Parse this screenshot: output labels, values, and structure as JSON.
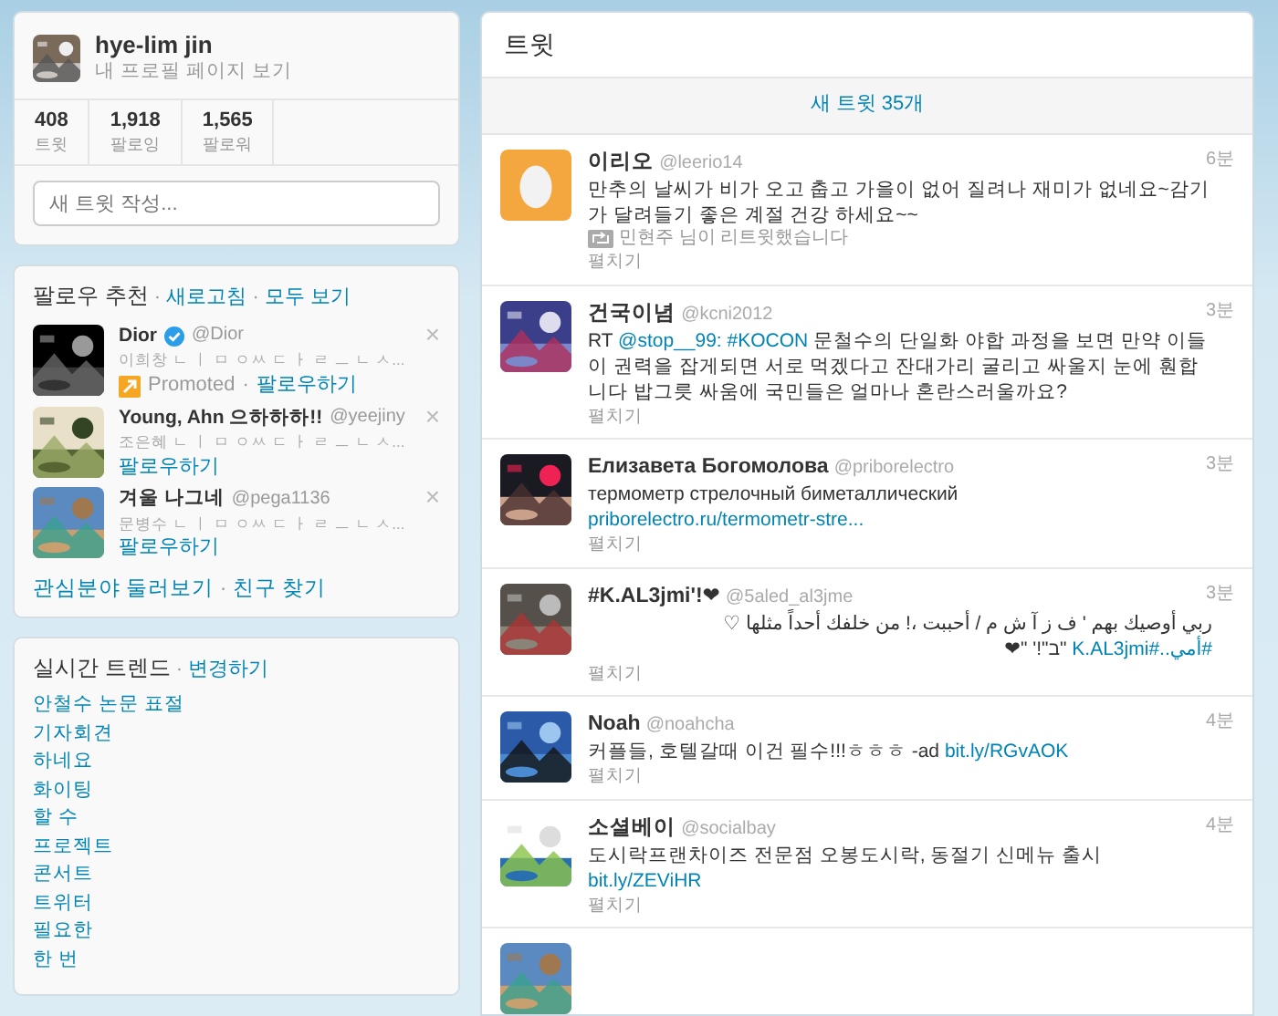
{
  "profile": {
    "name": "hye-lim jin",
    "link": "내 프로필 페이지 보기",
    "stats": [
      {
        "value": "408",
        "label": "트윗"
      },
      {
        "value": "1,918",
        "label": "팔로잉"
      },
      {
        "value": "1,565",
        "label": "팔로워"
      }
    ],
    "compose": {
      "placeholder": "새 트윗 작성..."
    }
  },
  "suggestions": {
    "header": [
      {
        "kind": "title",
        "text": "팔로우 추천"
      },
      {
        "kind": "sep",
        "text": "·"
      },
      {
        "kind": "link",
        "text": "새로고침"
      },
      {
        "kind": "sep",
        "text": "·"
      },
      {
        "kind": "link",
        "text": "모두 보기"
      }
    ],
    "items": [
      {
        "name": "Dior",
        "verified": true,
        "handle": "@Dior",
        "hint": "이희창 ㄴ ㅣ ㅁ ㅇㅆ ㄷ ㅏ ㄹ ㅡ ㄴ ㅅ...",
        "promoted": "Promoted",
        "sep": "·",
        "follow": "팔로우하기",
        "dismiss": "×"
      },
      {
        "name": "Young, Ahn 으하하하!!",
        "verified": false,
        "handle": "@yeejiny",
        "hint": "조은혜 ㄴ ㅣ ㅁ ㅇㅆ ㄷ ㅏ ㄹ ㅡ ㄴ ㅅ...",
        "follow": "팔로우하기",
        "dismiss": "×"
      },
      {
        "name": "겨울 나그네",
        "verified": false,
        "handle": "@pega1136",
        "hint": "문병수 ㄴ ㅣ ㅁ ㅇㅆ ㄷ ㅏ ㄹ ㅡ ㄴ ㅅ...",
        "follow": "팔로우하기",
        "dismiss": "×"
      }
    ],
    "footer": [
      {
        "kind": "link",
        "text": "관심분야 둘러보기"
      },
      {
        "kind": "sep",
        "text": "·"
      },
      {
        "kind": "link",
        "text": "친구 찾기"
      }
    ]
  },
  "trends": {
    "header": [
      {
        "kind": "title",
        "text": "실시간 트렌드"
      },
      {
        "kind": "sep",
        "text": "·"
      },
      {
        "kind": "link",
        "text": "변경하기"
      }
    ],
    "items": [
      "안철수 논문 표절",
      "기자회견",
      "하네요",
      "화이팅",
      "할 수",
      "프로젝트",
      "콘서트",
      "트위터",
      "필요한",
      "한 번"
    ]
  },
  "timeline": {
    "title": "트윗",
    "new_tweets": "새 트윗 35개",
    "tweets": [
      {
        "avatar": {
          "kind": "egg"
        },
        "name": "이리오",
        "handle": "@leerio14",
        "time": "6분",
        "body": [
          {
            "kind": "text",
            "text": "만추의 날씨가 비가 오고 춥고 가을이 없어 질려나 재미가 없네요~감기가 달려들기 좋은 계절 건강 하세요~~"
          }
        ],
        "retweet": "민현주 님이 리트윗했습니다",
        "expand": "펼치기"
      },
      {
        "avatar": {
          "kind": "picture"
        },
        "name": "건국이념",
        "handle": "@kcni2012",
        "time": "3분",
        "body": [
          {
            "kind": "text",
            "text": "RT "
          },
          {
            "kind": "link",
            "text": "@stop__99:"
          },
          {
            "kind": "link",
            "text": "#KOCON"
          },
          {
            "kind": "text",
            "text": " 문철수의 단일화 야합 과정을 보면 만약 이들이 권력을 잡게되면 서로 먹겠다고 잔대가리 굴리고 싸울지 눈에 훤합니다 밥그릇 싸움에 국민들은 얼마나 혼란스러울까요?"
          }
        ],
        "expand": "펼치기"
      },
      {
        "avatar": {
          "kind": "picture"
        },
        "name": "Елизавета Богомолова",
        "handle": "@priborelectro",
        "time": "3분",
        "body": [
          {
            "kind": "text",
            "text": "термометр стрелочный биметаллический "
          },
          {
            "kind": "link",
            "text": "priborelectro.ru/termometr-stre..."
          }
        ],
        "expand": "펼치기"
      },
      {
        "avatar": {
          "kind": "picture"
        },
        "name": "#K.AL3jmi'!❤",
        "handle": "@5aled_al3jme",
        "time": "3분",
        "rtl": true,
        "body": [
          {
            "kind": "text",
            "text": "ربي أوصيك بهم ' ف ز آ ش م / أحببت ،! من خلفك أحداً مثلها ♡ "
          },
          {
            "kind": "link",
            "text": "#أمي..#K.AL3jmi"
          },
          {
            "kind": "text",
            "text": " \"ב\"!' \"❤"
          }
        ],
        "expand": "펼치기"
      },
      {
        "avatar": {
          "kind": "picture"
        },
        "name": "Noah",
        "handle": "@noahcha",
        "time": "4분",
        "body": [
          {
            "kind": "text",
            "text": "커플들, 호텔갈때 이건 필수!!!ㅎㅎㅎ -ad "
          },
          {
            "kind": "link",
            "text": "bit.ly/RGvAOK"
          }
        ],
        "expand": "펼치기"
      },
      {
        "avatar": {
          "kind": "picture"
        },
        "name": "소셜베이",
        "handle": "@socialbay",
        "time": "4분",
        "body": [
          {
            "kind": "text",
            "text": "도시락프랜차이즈 전문점 오봉도시락, 동절기 신메뉴 출시 "
          },
          {
            "kind": "link",
            "text": "bit.ly/ZEViHR"
          }
        ],
        "expand": "펼치기"
      }
    ]
  }
}
